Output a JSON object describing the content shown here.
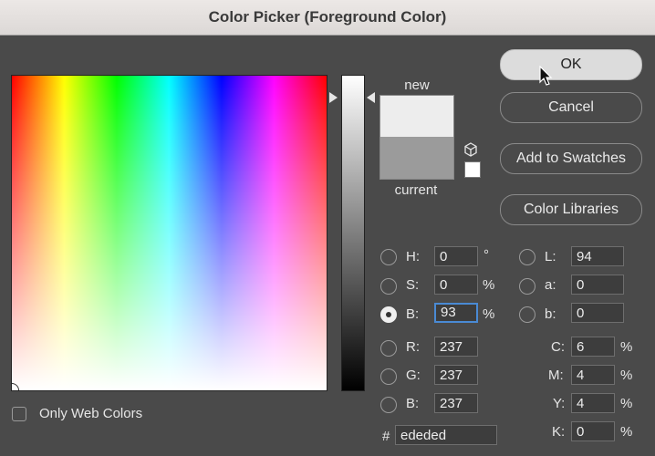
{
  "window": {
    "title": "Color Picker (Foreground Color)"
  },
  "preview": {
    "new_label": "new",
    "current_label": "current",
    "new_color": "#ededed",
    "current_color": "#9b9b9b"
  },
  "buttons": {
    "ok": "OK",
    "cancel": "Cancel",
    "add_to_swatches": "Add to Swatches",
    "color_libraries": "Color Libraries"
  },
  "hsb": {
    "h": {
      "label": "H:",
      "value": "0",
      "unit": "°"
    },
    "s": {
      "label": "S:",
      "value": "0",
      "unit": "%"
    },
    "b": {
      "label": "B:",
      "value": "93",
      "unit": "%"
    }
  },
  "rgb": {
    "r": {
      "label": "R:",
      "value": "237"
    },
    "g": {
      "label": "G:",
      "value": "237"
    },
    "b": {
      "label": "B:",
      "value": "237"
    }
  },
  "lab": {
    "l": {
      "label": "L:",
      "value": "94"
    },
    "a": {
      "label": "a:",
      "value": "0"
    },
    "b": {
      "label": "b:",
      "value": "0"
    }
  },
  "cmyk": {
    "c": {
      "label": "C:",
      "value": "6",
      "unit": "%"
    },
    "m": {
      "label": "M:",
      "value": "4",
      "unit": "%"
    },
    "y": {
      "label": "Y:",
      "value": "4",
      "unit": "%"
    },
    "k": {
      "label": "K:",
      "value": "0",
      "unit": "%"
    }
  },
  "hex": {
    "label": "#",
    "value": "ededed"
  },
  "only_web_colors": {
    "label": "Only Web Colors",
    "checked": false
  },
  "selected_mode": "brightness"
}
